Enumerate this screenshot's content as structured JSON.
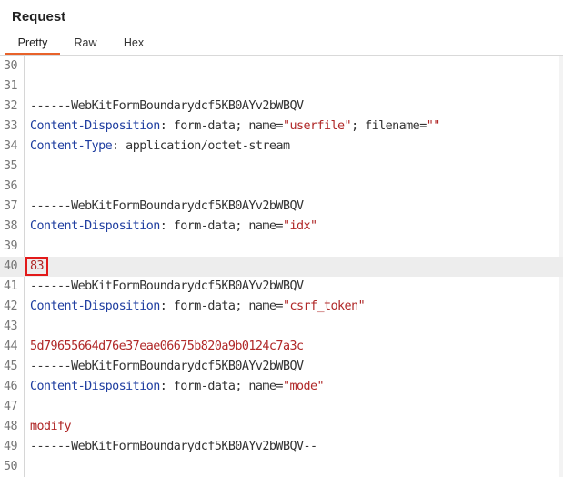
{
  "panel": {
    "title": "Request",
    "tabs": [
      {
        "label": "Pretty",
        "active": true
      },
      {
        "label": "Raw",
        "active": false
      },
      {
        "label": "Hex",
        "active": false
      }
    ]
  },
  "lines": [
    {
      "n": "30"
    },
    {
      "n": "31"
    },
    {
      "n": "32",
      "text": "------WebKitFormBoundarydcf5KB0AYv2bWBQV"
    },
    {
      "n": "33",
      "h": "Content-Disposition",
      "v": ": form-data; name=",
      "q1": "\"userfile\"",
      "v2": "; filename=",
      "q2": "\"\""
    },
    {
      "n": "34",
      "h": "Content-Type",
      "v": ": application/octet-stream"
    },
    {
      "n": "35"
    },
    {
      "n": "36"
    },
    {
      "n": "37",
      "text": "------WebKitFormBoundarydcf5KB0AYv2bWBQV"
    },
    {
      "n": "38",
      "h": "Content-Disposition",
      "v": ": form-data; name=",
      "q1": "\"idx\""
    },
    {
      "n": "39"
    },
    {
      "n": "40",
      "body": "83",
      "highlighted": true
    },
    {
      "n": "41",
      "text": "------WebKitFormBoundarydcf5KB0AYv2bWBQV"
    },
    {
      "n": "42",
      "h": "Content-Disposition",
      "v": ": form-data; name=",
      "q1": "\"csrf_token\""
    },
    {
      "n": "43"
    },
    {
      "n": "44",
      "body": "5d79655664d76e37eae06675b820a9b0124c7a3c"
    },
    {
      "n": "45",
      "text": "------WebKitFormBoundarydcf5KB0AYv2bWBQV"
    },
    {
      "n": "46",
      "h": "Content-Disposition",
      "v": ": form-data; name=",
      "q1": "\"mode\""
    },
    {
      "n": "47"
    },
    {
      "n": "48",
      "body": "modify"
    },
    {
      "n": "49",
      "text": "------WebKitFormBoundarydcf5KB0AYv2bWBQV--"
    },
    {
      "n": "50"
    }
  ],
  "colors": {
    "header_name": "#1f3ea0",
    "string_value": "#b02828",
    "active_tab_underline": "#e8622a",
    "annotation_box": "#e21a1a"
  }
}
